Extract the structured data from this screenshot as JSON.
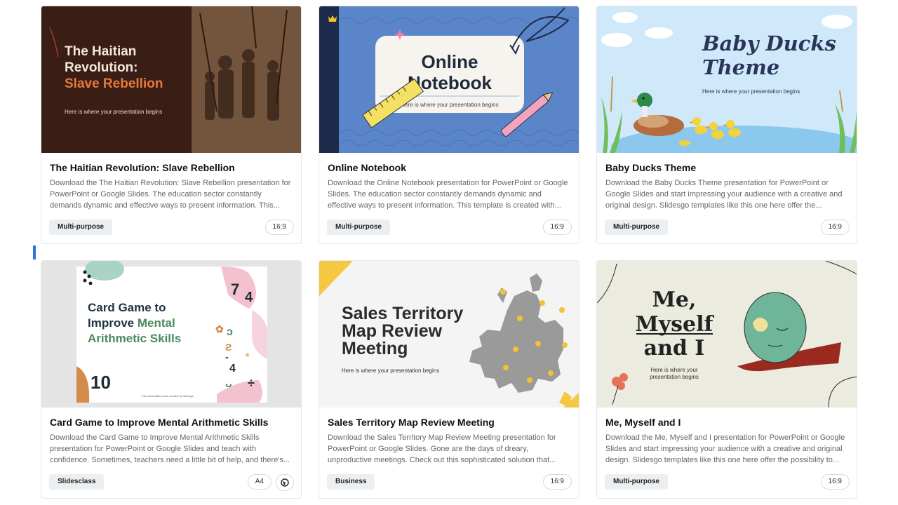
{
  "cards": [
    {
      "title": "The Haitian Revolution: Slave Rebellion",
      "description": "Download the The Haitian Revolution: Slave Rebellion presentation for PowerPoint or Google Slides. The education sector constantly demands dynamic and effective ways to present information. This...",
      "tag": "Multi-purpose",
      "ratio": "16:9",
      "thumb": {
        "line1": "The Haitian",
        "line2": "Revolution:",
        "line3": "Slave Rebellion",
        "subtitle": "Here is where your presentation begins",
        "bg": "#3a1d14",
        "accent": "#e8783a"
      }
    },
    {
      "title": "Online Notebook",
      "description": "Download the Online Notebook presentation for PowerPoint or Google Slides. The education sector constantly demands dynamic and effective ways to present information. This template is created with...",
      "tag": "Multi-purpose",
      "ratio": "16:9",
      "thumb": {
        "line1": "Online",
        "line2": "Notebook",
        "subtitle": "Here is where your presentation begins",
        "bg": "#5a86c9",
        "premium_icon": "crown-icon"
      }
    },
    {
      "title": "Baby Ducks Theme",
      "description": "Download the Baby Ducks Theme presentation for PowerPoint or Google Slides and start impressing your audience with a creative and original design. Slidesgo templates like this one here offer the...",
      "tag": "Multi-purpose",
      "ratio": "16:9",
      "thumb": {
        "line1": "Baby Ducks",
        "line2": "Theme",
        "subtitle": "Here is where your presentation begins",
        "bg": "#cfe9fb"
      }
    },
    {
      "title": "Card Game to Improve Mental Arithmetic Skills",
      "description": "Download the Card Game to Improve Mental Arithmetic Skills presentation for PowerPoint or Google Slides and teach with confidence. Sometimes, teachers need a little bit of help, and there's...",
      "tag": "Slidesclass",
      "ratio": "A4",
      "extra_icon": "globe-icon",
      "thumb": {
        "line1": "Card Game to",
        "line2a": "Improve ",
        "line2b": "Mental",
        "line3": "Arithmetic Skills",
        "number": "10",
        "footer": "This presentation was created by Slidesgo",
        "bg": "#e4e4e4"
      }
    },
    {
      "title": "Sales Territory Map Review Meeting",
      "description": "Download the Sales Territory Map Review Meeting presentation for PowerPoint or Google Slides. Gone are the days of dreary, unproductive meetings. Check out this sophisticated solution that...",
      "tag": "Business",
      "ratio": "16:9",
      "thumb": {
        "line1": "Sales Territory",
        "line2": "Map Review",
        "line3": "Meeting",
        "subtitle": "Here is where your presentation begins",
        "bg": "#f4f4f4",
        "accent": "#f5c842"
      }
    },
    {
      "title": "Me, Myself and I",
      "description": "Download the Me, Myself and I presentation for PowerPoint or Google Slides and start impressing your audience with a creative and original design. Slidesgo templates like this one here offer the possibility to...",
      "tag": "Multi-purpose",
      "ratio": "16:9",
      "thumb": {
        "line1": "Me,",
        "line2": "Myself",
        "line3": "and I",
        "subtitle1": "Here is where your",
        "subtitle2": "presentation begins",
        "bg": "#ecebe0"
      }
    }
  ]
}
